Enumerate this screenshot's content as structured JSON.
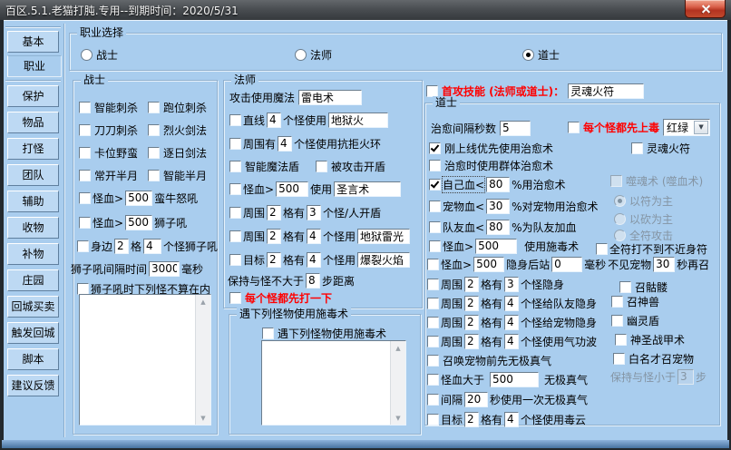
{
  "window": {
    "title": "百区.5.1.老猫打肫.专用--到期时间：2020/5/31"
  },
  "colors": {
    "client_bg": "#a9cdee",
    "button_bg": "#bdd9f3",
    "alert_red": "#ff0000",
    "close_red": "#b33320"
  },
  "icons": {
    "close": "x-mark",
    "dropdown": "▼",
    "scroll_up": "▲",
    "scroll_down": "▼"
  },
  "sidebar": {
    "items": [
      {
        "label": "基本",
        "active": false
      },
      {
        "label": "职业",
        "active": true
      },
      {
        "label": "保护",
        "active": false
      },
      {
        "label": "物品",
        "active": false
      },
      {
        "label": "打怪",
        "active": false
      },
      {
        "label": "团队",
        "active": false
      },
      {
        "label": "辅助",
        "active": false
      },
      {
        "label": "收物",
        "active": false
      },
      {
        "label": "补物",
        "active": false
      },
      {
        "label": "庄园",
        "active": false
      },
      {
        "label": "回城买卖",
        "active": false
      },
      {
        "label": "触发回城",
        "active": false
      },
      {
        "label": "脚本",
        "active": false
      },
      {
        "label": "建议反馈",
        "active": false
      }
    ]
  },
  "profession": {
    "group_label": "职业选择",
    "options": [
      {
        "label": "战士",
        "selected": false
      },
      {
        "label": "法师",
        "selected": false
      },
      {
        "label": "道士",
        "selected": true
      }
    ]
  },
  "warrior": {
    "group_label": "战士",
    "checkboxes": [
      {
        "label": "智能刺杀",
        "checked": false
      },
      {
        "label": "跑位刺杀",
        "checked": false
      },
      {
        "label": "刀刀刺杀",
        "checked": false
      },
      {
        "label": "烈火剑法",
        "checked": false
      },
      {
        "label": "卡位野蛮",
        "checked": false
      },
      {
        "label": "逐日剑法",
        "checked": false
      },
      {
        "label": "常开半月",
        "checked": false
      },
      {
        "label": "智能半月",
        "checked": false
      }
    ],
    "bull_roar": {
      "pre": "怪血>",
      "value": "500",
      "post": "蛮牛怒吼",
      "checked": false
    },
    "lion_roar": {
      "pre": "怪血>",
      "value": "500",
      "post": "狮子吼",
      "checked": false
    },
    "nearby": {
      "pre": "身边",
      "grid": "2",
      "mid": "格",
      "count": "4",
      "post": "个怪狮子吼",
      "checked": false
    },
    "roar_interval": {
      "pre": "狮子吼间隔时间",
      "value": "3000",
      "post": "毫秒"
    },
    "exclude": {
      "label": "狮子吼时下列怪不算在内",
      "checked": false
    },
    "exclude_list": []
  },
  "mage": {
    "group_label": "法师",
    "attack": {
      "label": "攻击使用魔法",
      "value": "雷电术"
    },
    "line": {
      "label": "直线",
      "count": "4",
      "mid": "个怪使用",
      "value": "地狱火",
      "checked": false
    },
    "ring": {
      "label": "周围有",
      "count": "4",
      "post": "个怪使用抗拒火环",
      "checked": false
    },
    "smart_shield": {
      "label": "智能魔法盾",
      "checked": false
    },
    "hit_shield": {
      "label": "被攻击开盾",
      "checked": false
    },
    "holy_word": {
      "label": "怪血>",
      "value": "500",
      "mid": "使用",
      "spell": "圣言术",
      "checked": false
    },
    "around_shield": {
      "label": "周围",
      "grid": "2",
      "mid": "格有",
      "count": "3",
      "post": "个怪/人开盾",
      "checked": false
    },
    "thunder": {
      "label": "周围",
      "grid": "2",
      "mid": "格有",
      "count": "4",
      "mid2": "个怪用",
      "spell": "地狱雷光",
      "checked": false
    },
    "blast": {
      "label": "目标",
      "grid": "2",
      "mid": "格有",
      "count": "4",
      "mid2": "个怪用",
      "spell": "爆裂火焰",
      "checked": false
    },
    "keep_distance": {
      "pre": "保持与怪不大于",
      "value": "8",
      "post": "步距离"
    },
    "hit_first": {
      "label": "每个怪都先打一下",
      "checked": false
    }
  },
  "poison_list": {
    "group_label": "遇下列怪物使用施毒术",
    "checkbox_label": "遇下列怪物使用施毒术",
    "checked": false,
    "items": []
  },
  "first_attack": {
    "label": "首攻技能 (法师或道士)：",
    "value": "灵魂火符",
    "checked": false
  },
  "taoist": {
    "group_label": "道士",
    "heal_interval": {
      "label": "治愈间隔秒数",
      "value": "5"
    },
    "pre_poison": {
      "label": "每个怪都先上毒",
      "value": "红绿",
      "checked": false
    },
    "heal_on_login": {
      "label": "刚上线优先使用治愈术",
      "checked": true
    },
    "soul_talisman": {
      "label": "灵魂火符",
      "checked": false
    },
    "group_heal": {
      "label": "治愈时使用群体治愈术",
      "checked": false
    },
    "self_heal": {
      "label": "自己血<",
      "value": "80",
      "post": "%用治愈术",
      "checked": true
    },
    "pet_heal": {
      "label": "宠物血<",
      "value": "30",
      "post": "%对宠物用治愈术",
      "checked": false
    },
    "team_heal": {
      "label": "队友血<",
      "value": "80",
      "post": "%为队友加血",
      "checked": false
    },
    "poison_hp": {
      "label": "怪血>",
      "value": "500",
      "post": "使用施毒术",
      "checked": false
    },
    "soul_drain": {
      "label": "噬魂术 (噬血术)",
      "checked": false,
      "disabled": true
    },
    "mode_talisman": {
      "label": "以符为主",
      "selected": true,
      "disabled": true
    },
    "mode_melee": {
      "label": "以砍为主",
      "selected": false,
      "disabled": true
    },
    "mode_all_talisman": {
      "label": "全符攻击",
      "selected": false,
      "disabled": true
    },
    "no_near": {
      "label": "全符打不到不近身符",
      "checked": false
    },
    "hide": {
      "label": "怪血>",
      "value": "500",
      "mid1": "隐身后站",
      "value2": "0",
      "mid2": "毫秒",
      "mid3": "不见宠物",
      "value3": "30",
      "post": "秒再召",
      "checked": false
    },
    "hide_self": {
      "label": "周围",
      "grid": "2",
      "mid": "格有",
      "count": "3",
      "post": "个怪隐身",
      "checked": false
    },
    "hide_team": {
      "label": "周围",
      "grid": "2",
      "mid": "格有",
      "count": "4",
      "post": "个怪给队友隐身",
      "checked": false
    },
    "hide_pet": {
      "label": "周围",
      "grid": "2",
      "mid": "格有",
      "count": "4",
      "post": "个怪给宠物隐身",
      "checked": false
    },
    "qigong": {
      "label": "周围",
      "grid": "2",
      "mid": "格有",
      "count": "4",
      "post": "个怪使用气功波",
      "checked": false
    },
    "summon_skeleton": {
      "label": "召骷髅",
      "checked": false
    },
    "summon_beast": {
      "label": "召神兽",
      "checked": false
    },
    "ghost_shield": {
      "label": "幽灵盾",
      "checked": false
    },
    "holy_armor": {
      "label": "神圣战甲术",
      "checked": false
    },
    "qi_before_summon": {
      "label": "召唤宠物前先无极真气",
      "checked": false
    },
    "white_name_summon": {
      "label": "白名才召宠物",
      "checked": false
    },
    "qi_hp": {
      "label": "怪血大于",
      "value": "500",
      "post": "无极真气",
      "checked": false
    },
    "keep_small": {
      "label": "保持与怪小于",
      "value": "3",
      "post": "步",
      "disabled": true
    },
    "qi_interval": {
      "label": "间隔",
      "value": "20",
      "post": "秒使用一次无极真气",
      "checked": false
    },
    "poison_cloud": {
      "label": "目标",
      "grid": "2",
      "mid": "格有",
      "count": "4",
      "post": "个怪使用毒云",
      "checked": false
    }
  }
}
